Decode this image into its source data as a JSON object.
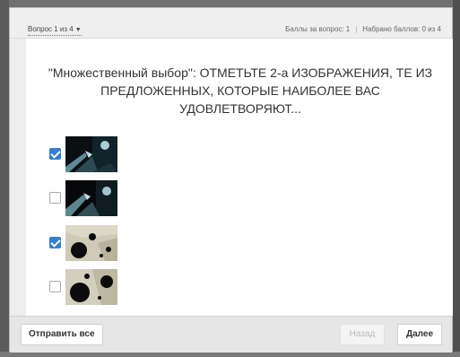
{
  "topbar": {
    "question_selector": "Вопрос 1 из 4",
    "points_per_question": "Баллы за вопрос: 1",
    "points_total": "Набрано баллов: 0 из 4"
  },
  "question": {
    "text": "\"Множественный выбор\": ОТМЕТЬТЕ 2-а ИЗОБРАЖЕНИЯ, ТЕ ИЗ ПРЕДЛОЖЕННЫХ, КОТОРЫЕ НАИБОЛЕЕ ВАС УДОВЛЕТВОРЯЮТ..."
  },
  "options": [
    {
      "checked": true,
      "image": "dark-space-scene-1"
    },
    {
      "checked": false,
      "image": "dark-space-scene-2"
    },
    {
      "checked": true,
      "image": "light-circles-scene-1"
    },
    {
      "checked": false,
      "image": "light-circles-scene-2"
    }
  ],
  "buttons": {
    "submit_all": "Отправить все",
    "back": "Назад",
    "next": "Далее"
  },
  "colors": {
    "accent": "#2f7ed8"
  }
}
